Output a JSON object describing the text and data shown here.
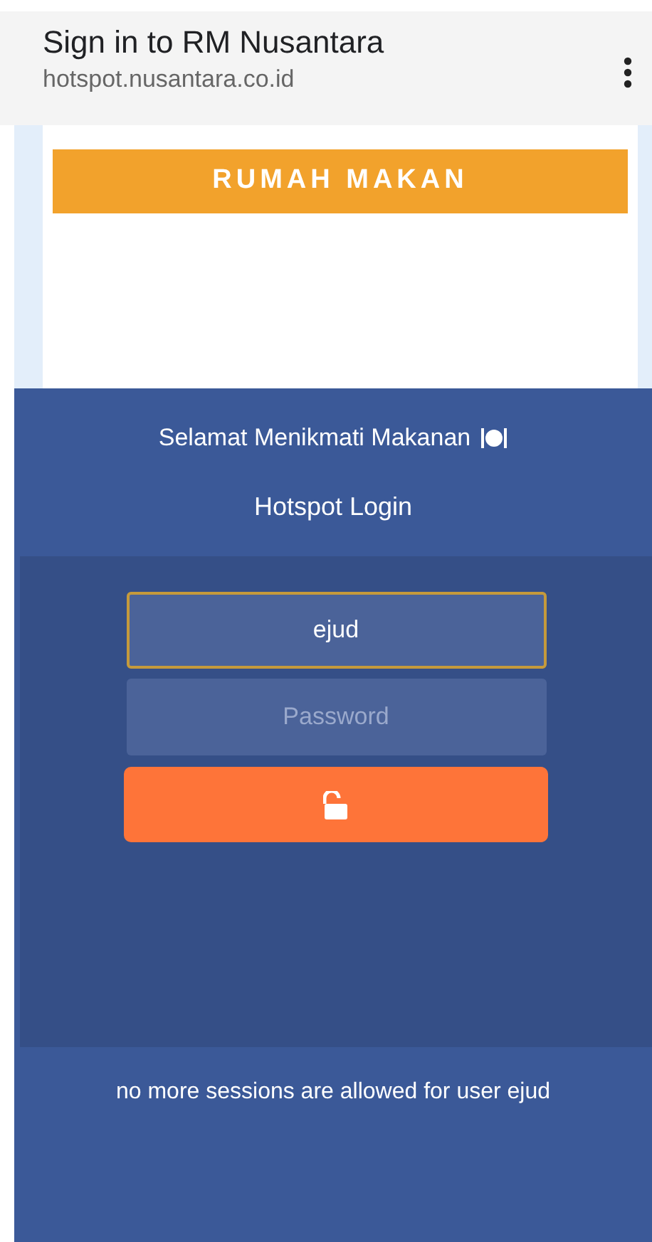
{
  "browser_bar": {
    "title": "Sign in to RM Nusantara",
    "url": "hotspot.nusantara.co.id"
  },
  "banner": {
    "label": "RUMAH MAKAN"
  },
  "welcome": "Selamat Menikmati Makanan",
  "heading": "Hotspot Login",
  "fields": [
    {
      "kind": "text",
      "value": "ejud",
      "focused": true
    },
    {
      "kind": "password",
      "placeholder": "Password",
      "focused": false
    }
  ],
  "error_message": "no more sessions are allowed for user ejud"
}
